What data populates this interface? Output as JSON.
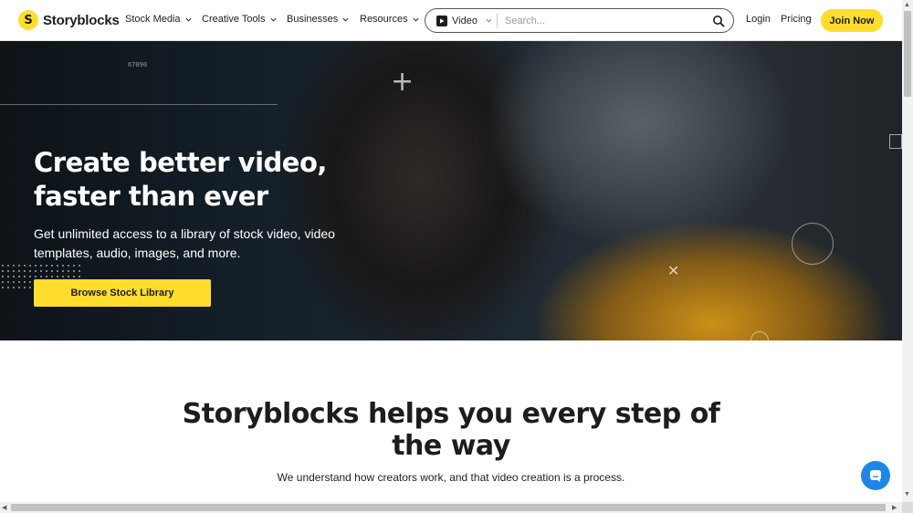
{
  "brand": {
    "name": "Storyblocks",
    "mark": "S"
  },
  "nav": {
    "items": [
      {
        "label": "Stock Media"
      },
      {
        "label": "Creative Tools"
      },
      {
        "label": "Businesses"
      },
      {
        "label": "Resources"
      }
    ],
    "login": "Login",
    "pricing": "Pricing",
    "join": "Join Now"
  },
  "search": {
    "type": "Video",
    "placeholder": "Search..."
  },
  "hero": {
    "code": "67090",
    "title": "Create better video, faster than ever",
    "subtitle": "Get unlimited access to a library of stock video, video templates, audio, images, and more.",
    "cta": "Browse Stock Library"
  },
  "section": {
    "title": "Storyblocks helps you every step of the way",
    "subtitle": "We understand how creators work, and that video creation is a process."
  },
  "colors": {
    "accent": "#ffdd2d",
    "chat": "#1e86e8",
    "text": "#1d1d1d"
  },
  "icons": [
    "logo-mark-icon",
    "chevron-down-icon",
    "video-play-icon",
    "search-icon",
    "chat-icon"
  ]
}
